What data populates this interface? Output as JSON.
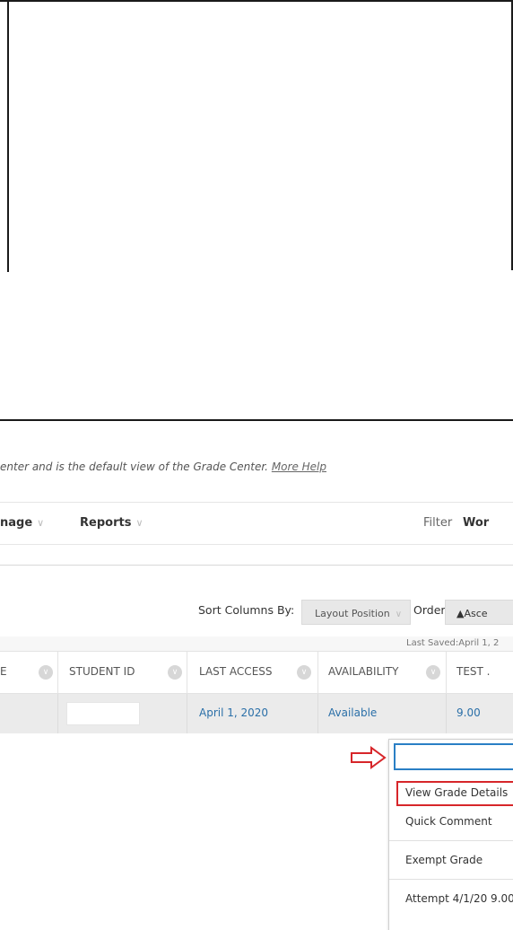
{
  "help": {
    "text": "enter and is the default view of the Grade Center. ",
    "link": "More Help"
  },
  "menu": {
    "manage": "nage",
    "reports": "Reports",
    "filter": "Filter",
    "work_offline": "Wor"
  },
  "sort": {
    "label": "Sort Columns By:",
    "selected": "Layout Position",
    "order_label": "Order:",
    "order_value": "▲Asce"
  },
  "last_saved": "Last Saved:April 1, 2",
  "columns": [
    "E",
    "STUDENT ID",
    "LAST ACCESS",
    "AVAILABILITY",
    "TEST ."
  ],
  "row": {
    "last_access": "April 1, 2020",
    "availability": "Available",
    "test_score": "9.00"
  },
  "context_menu": {
    "items": [
      "View Grade Details",
      "Quick Comment",
      "Exempt Grade",
      "Attempt 4/1/20 9.00"
    ]
  },
  "colors": {
    "accent": "#2a6fa8",
    "highlight": "#d7262a",
    "search_border": "#2a7fc5"
  }
}
